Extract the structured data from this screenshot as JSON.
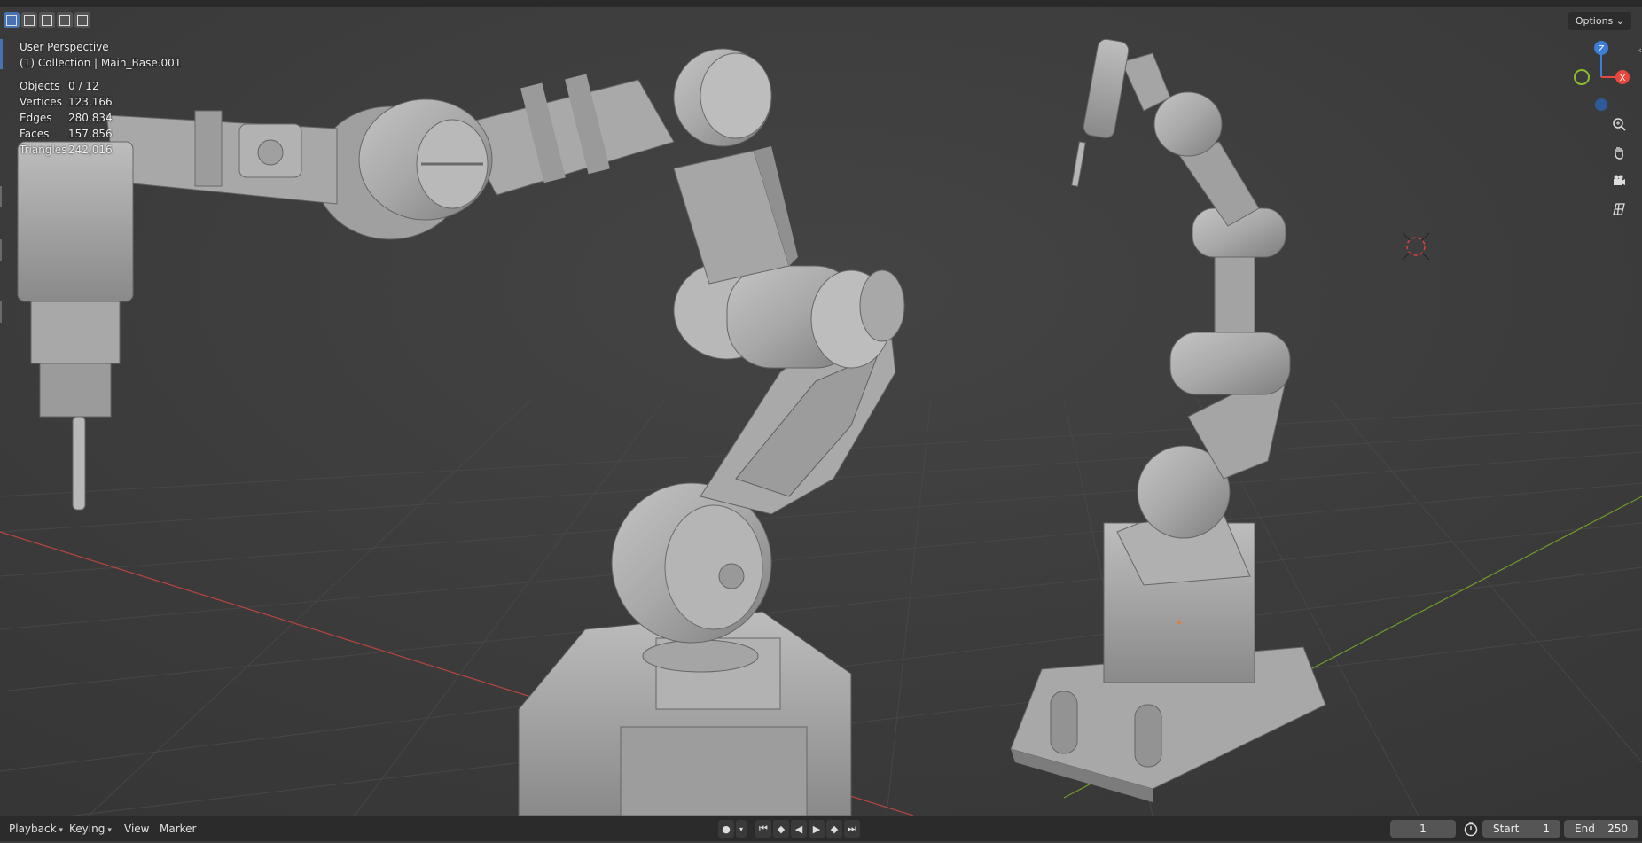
{
  "viewport": {
    "perspective_label": "User Perspective",
    "collection_label": "(1) Collection | Main_Base.001",
    "stats": [
      {
        "label": "Objects",
        "value": "0 / 12"
      },
      {
        "label": "Vertices",
        "value": "123,166"
      },
      {
        "label": "Edges",
        "value": "280,834"
      },
      {
        "label": "Faces",
        "value": "157,856"
      },
      {
        "label": "Triangles",
        "value": "242,016"
      }
    ],
    "options_label": "Options",
    "gizmo": {
      "z": "Z",
      "x": "X"
    }
  },
  "timeline": {
    "playback_label": "Playback",
    "keying_label": "Keying",
    "view_label": "View",
    "marker_label": "Marker",
    "current_frame": "1",
    "start_label": "Start",
    "start_value": "1",
    "end_label": "End",
    "end_value": "250"
  },
  "colors": {
    "accent": "#4772b3",
    "axis_x": "#e8473e",
    "axis_y": "#8bbd2f",
    "axis_z": "#3d7ed8"
  }
}
